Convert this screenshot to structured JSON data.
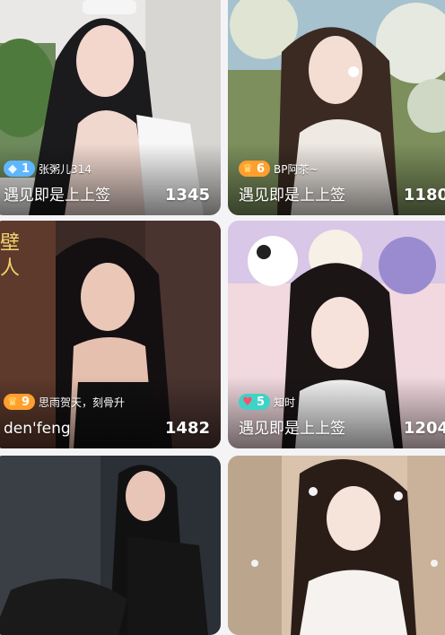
{
  "cards": [
    {
      "title": "遇见即是上上签",
      "count": "1345",
      "level": "1",
      "level_icon": "diamond-icon",
      "level_glyph": "◆",
      "level_color": "#5fb6ff",
      "username": "张粥儿314"
    },
    {
      "title": "遇见即是上上签",
      "count": "1180",
      "level": "6",
      "level_icon": "crown-icon",
      "level_glyph": "♛",
      "level_color": "#ff9f2e",
      "username": "BP阿茶~"
    },
    {
      "title": "den'feng",
      "count": "1482",
      "level": "9",
      "level_icon": "crown-icon",
      "level_glyph": "♛",
      "level_color": "#ff9f2e",
      "username": "思雨贺天，刻骨升"
    },
    {
      "title": "遇见即是上上签",
      "count": "1204",
      "level": "5",
      "level_icon": "heart-icon",
      "level_glyph": "♥",
      "level_color": "#3fd2c7",
      "username": "知时"
    },
    {
      "title": "",
      "count": "",
      "level": "",
      "level_icon": "",
      "username": ""
    },
    {
      "title": "",
      "count": "",
      "level": "",
      "level_icon": "",
      "username": ""
    }
  ]
}
